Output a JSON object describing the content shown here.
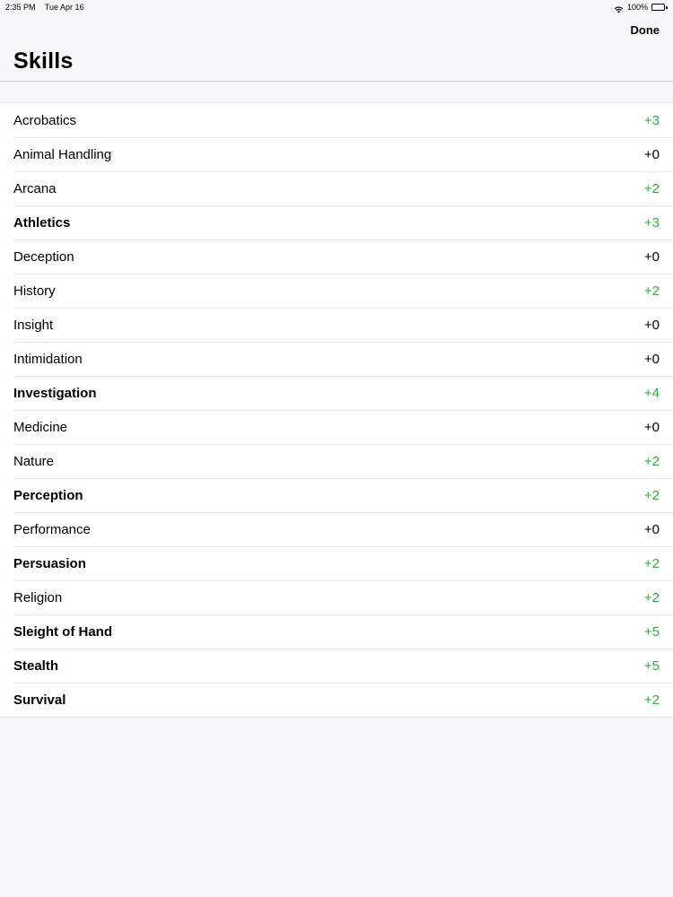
{
  "status_bar": {
    "time": "2:35 PM",
    "date": "Tue Apr 16",
    "battery": "100%",
    "icons": [
      "wifi-icon",
      "battery-icon"
    ]
  },
  "nav": {
    "done_label": "Done",
    "title": "Skills"
  },
  "colors": {
    "positive": "#2eaa3a",
    "neutral": "#000000",
    "background": "#f7f7f9",
    "row_background": "#ffffff"
  },
  "skills": [
    {
      "name": "Acrobatics",
      "modifier": "+3",
      "proficient": false
    },
    {
      "name": "Animal Handling",
      "modifier": "+0",
      "proficient": false
    },
    {
      "name": "Arcana",
      "modifier": "+2",
      "proficient": false
    },
    {
      "name": "Athletics",
      "modifier": "+3",
      "proficient": true
    },
    {
      "name": "Deception",
      "modifier": "+0",
      "proficient": false
    },
    {
      "name": "History",
      "modifier": "+2",
      "proficient": false
    },
    {
      "name": "Insight",
      "modifier": "+0",
      "proficient": false
    },
    {
      "name": "Intimidation",
      "modifier": "+0",
      "proficient": false
    },
    {
      "name": "Investigation",
      "modifier": "+4",
      "proficient": true
    },
    {
      "name": "Medicine",
      "modifier": "+0",
      "proficient": false
    },
    {
      "name": "Nature",
      "modifier": "+2",
      "proficient": false
    },
    {
      "name": "Perception",
      "modifier": "+2",
      "proficient": true
    },
    {
      "name": "Performance",
      "modifier": "+0",
      "proficient": false
    },
    {
      "name": "Persuasion",
      "modifier": "+2",
      "proficient": true
    },
    {
      "name": "Religion",
      "modifier": "+2",
      "proficient": false
    },
    {
      "name": "Sleight of Hand",
      "modifier": "+5",
      "proficient": true
    },
    {
      "name": "Stealth",
      "modifier": "+5",
      "proficient": true
    },
    {
      "name": "Survival",
      "modifier": "+2",
      "proficient": true
    }
  ]
}
